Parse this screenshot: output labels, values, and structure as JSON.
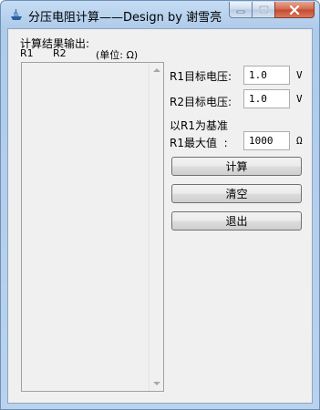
{
  "window": {
    "title": "分压电阻计算——Design by 谢雪亮",
    "buttons": {
      "minimize": "minimize",
      "maximize": "maximize",
      "close": "close"
    }
  },
  "output": {
    "heading": "计算结果输出:",
    "col_r1": "R1",
    "col_r2": "R2",
    "unit_note": "(单位: Ω)"
  },
  "form": {
    "r1_target_label": "R1目标电压:",
    "r1_target_value": "1.0",
    "r1_unit": "V",
    "r2_target_label": "R2目标电压:",
    "r2_target_value": "1.0",
    "r2_unit": "V",
    "base_note": "以R1为基准",
    "r1_max_label": "R1最大值  :",
    "r1_max_value": "1000",
    "r1_max_unit": "Ω"
  },
  "actions": {
    "calculate": "计算",
    "clear": "清空",
    "exit": "退出"
  },
  "colors": {
    "titlebar": "#b9d3ee",
    "client_bg": "#f0f0f0",
    "close_button": "#c44a2c"
  },
  "icons": {
    "app": "ship-icon",
    "min": "minimize-icon",
    "max": "maximize-icon",
    "close": "close-icon"
  }
}
